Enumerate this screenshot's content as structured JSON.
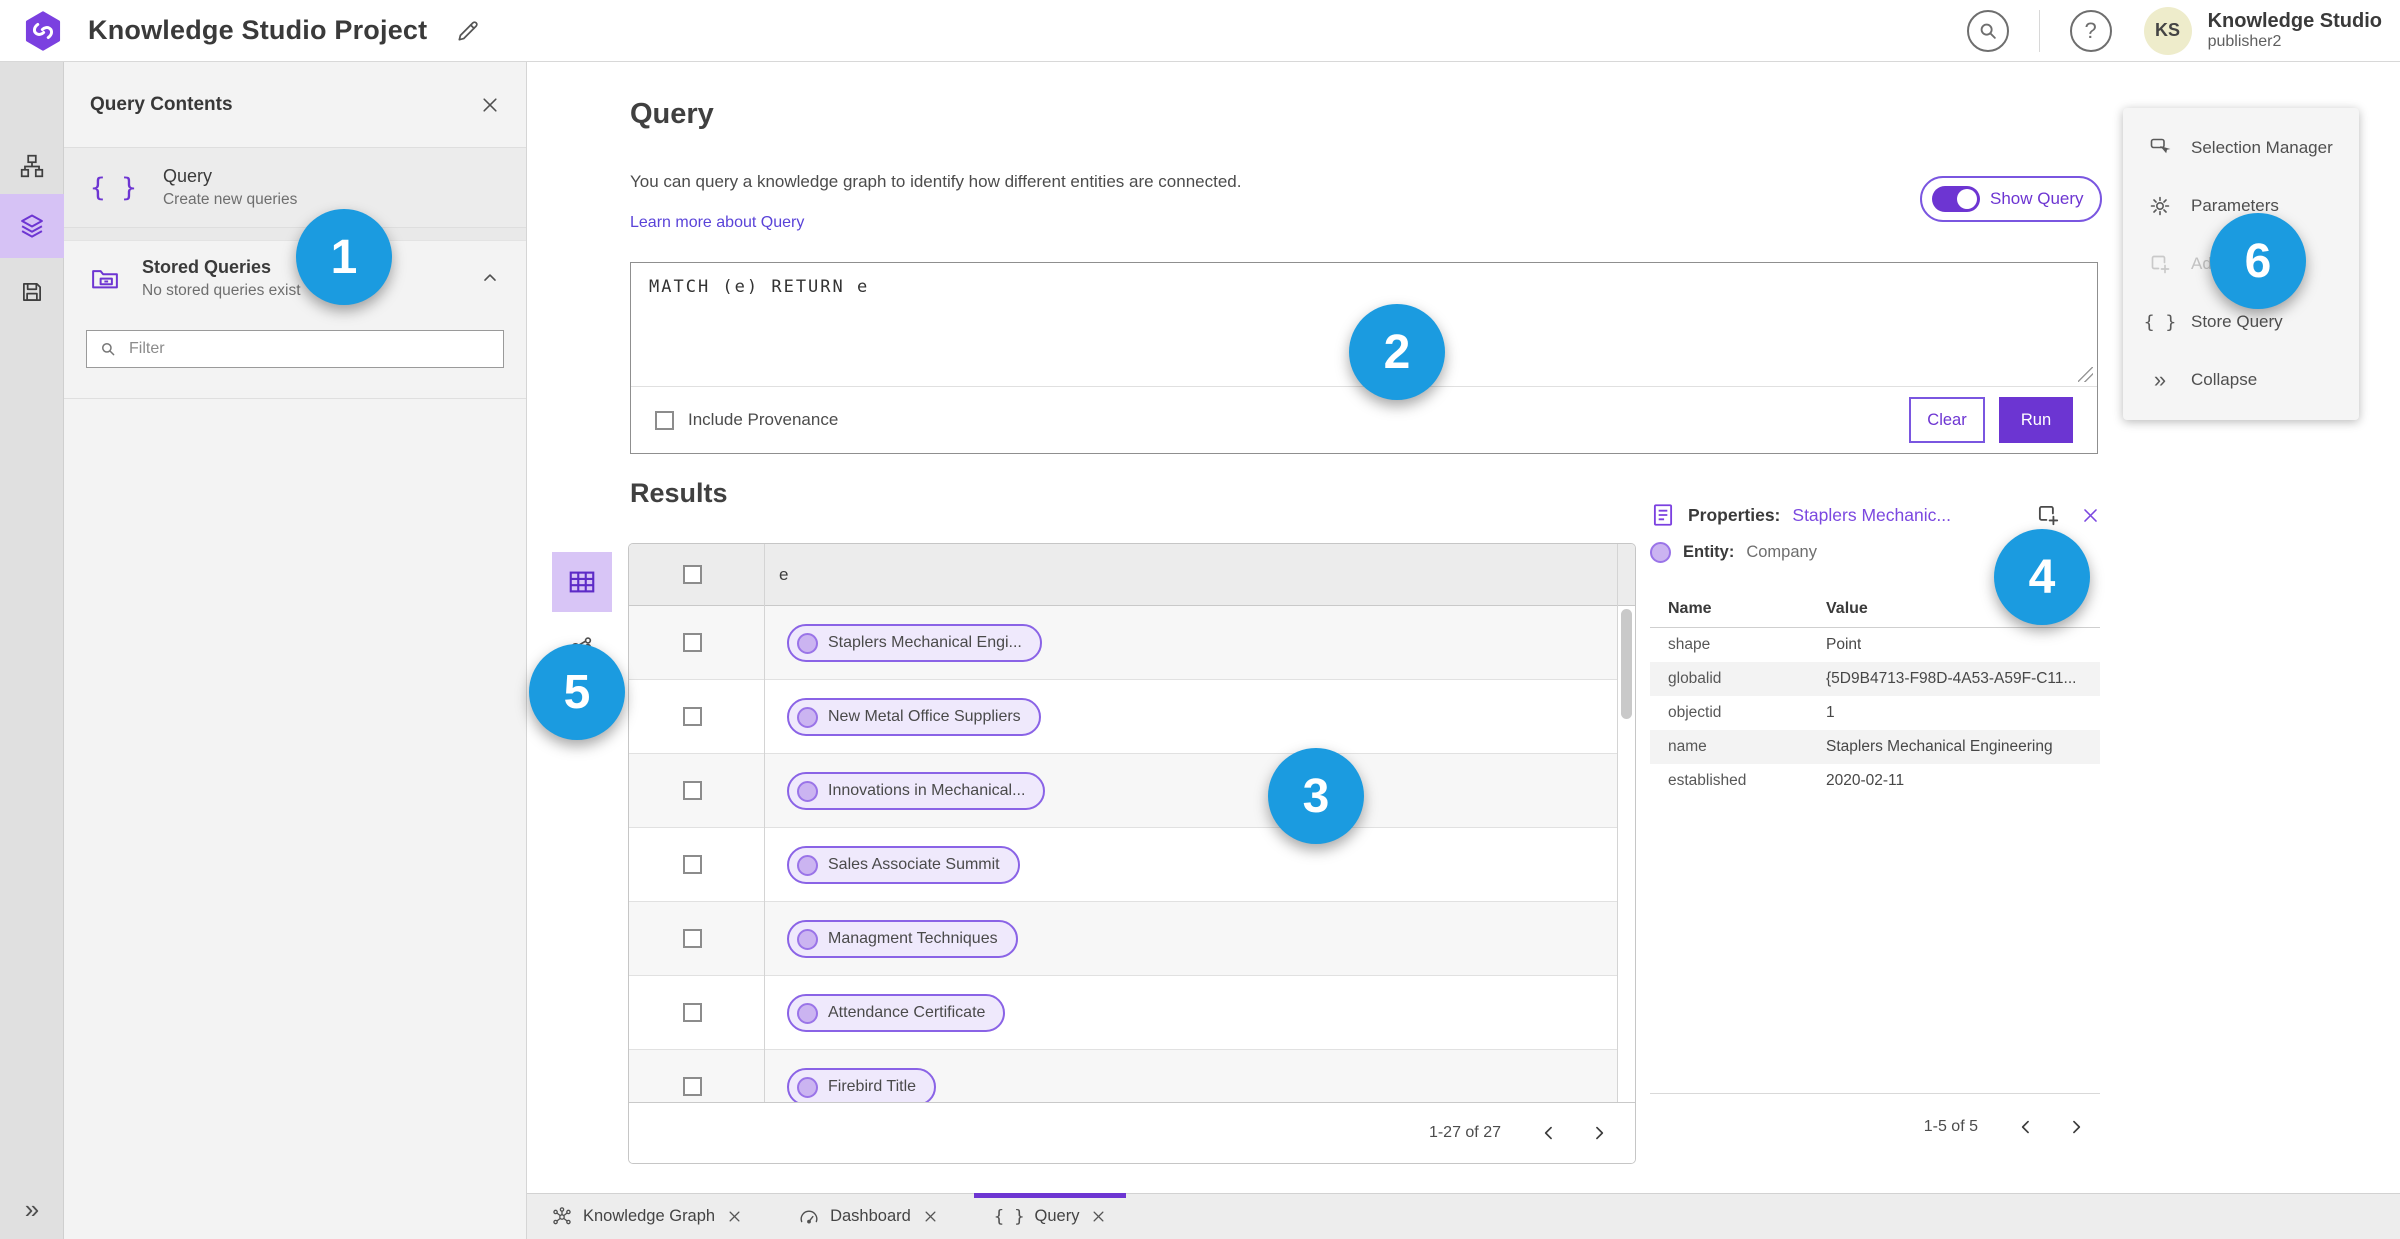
{
  "colors": {
    "accent": "#6d35d2",
    "marker_blue": "#1b9be0",
    "pill_border": "#8a63e6",
    "pill_bg": "#efe9fc"
  },
  "header": {
    "title": "Knowledge Studio Project",
    "avatar_initials": "KS",
    "user_name": "Knowledge Studio",
    "user_role": "publisher2"
  },
  "contents_panel": {
    "title": "Query Contents",
    "query_item": {
      "title": "Query",
      "subtitle": "Create new queries"
    },
    "stored_item": {
      "title": "Stored Queries",
      "subtitle": "No stored queries exist"
    },
    "filter_placeholder": "Filter"
  },
  "query_section": {
    "title": "Query",
    "description": "You can query a knowledge graph to identify how different entities are connected.",
    "learn_more": "Learn more about Query",
    "show_query_label": "Show Query",
    "query_text": "MATCH (e) RETURN e",
    "include_provenance": "Include Provenance",
    "clear_label": "Clear",
    "run_label": "Run"
  },
  "results": {
    "title": "Results",
    "column_header": "e",
    "rows": [
      "Staplers Mechanical Engi...",
      "New Metal Office Suppliers",
      "Innovations in Mechanical...",
      "Sales Associate Summit",
      "Managment Techniques",
      "Attendance Certificate",
      "Firebird Title"
    ],
    "pagination": "1-27 of 27"
  },
  "properties": {
    "title_label": "Properties:",
    "title_link": "Staplers Mechanic...",
    "entity_label": "Entity:",
    "entity_value": "Company",
    "col_name": "Name",
    "col_value": "Value",
    "rows": [
      {
        "name": "shape",
        "value": "Point"
      },
      {
        "name": "globalid",
        "value": "{5D9B4713-F98D-4A53-A59F-C11..."
      },
      {
        "name": "objectid",
        "value": "1"
      },
      {
        "name": "name",
        "value": "Staplers Mechanical Engineering"
      },
      {
        "name": "established",
        "value": "2020-02-11"
      }
    ],
    "pagination": "1-5 of 5"
  },
  "right_menu": {
    "items": [
      {
        "label": "Selection Manager"
      },
      {
        "label": "Parameters"
      },
      {
        "label": "Ad"
      },
      {
        "label": "Store Query"
      },
      {
        "label": "Collapse"
      }
    ]
  },
  "tabs": {
    "items": [
      {
        "label": "Knowledge Graph"
      },
      {
        "label": "Dashboard"
      },
      {
        "label": "Query"
      }
    ]
  },
  "markers": [
    "1",
    "2",
    "3",
    "4",
    "5",
    "6"
  ]
}
